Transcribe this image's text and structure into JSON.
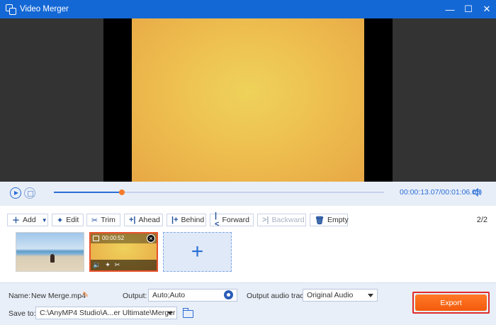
{
  "window": {
    "title": "Video Merger",
    "controls": {
      "minimize": "—",
      "maximize": "☐",
      "close": "✕"
    }
  },
  "player": {
    "current_time": "00:00:13.07",
    "separator": "/",
    "total_time": "00:01:06.05",
    "progress_fraction": 0.205
  },
  "toolbar": {
    "add": "Add",
    "edit": "Edit",
    "trim": "Trim",
    "ahead": "Ahead",
    "behind": "Behind",
    "forward": "Forward",
    "backward": "Backward",
    "empty": "Empty",
    "page_count": "2/2"
  },
  "clips": [
    {
      "thumbnail": "beach-person"
    },
    {
      "thumbnail": "yellow-frame",
      "duration": "00:00:52",
      "selected": true
    }
  ],
  "settings": {
    "name_label": "Name:",
    "name_value": "New Merge.mp4",
    "output_label": "Output:",
    "output_value": "Auto;Auto",
    "audio_label": "Output audio track:",
    "audio_value": "Original Audio",
    "save_label": "Save to:",
    "save_value": "C:\\AnyMP4 Studio\\A...er Ultimate\\Merger",
    "export_label": "Export"
  },
  "colors": {
    "titlebar": "#1468d6",
    "accent": "#2a6ed6",
    "export": "#f35a0c",
    "highlight": "#e02a2a"
  }
}
